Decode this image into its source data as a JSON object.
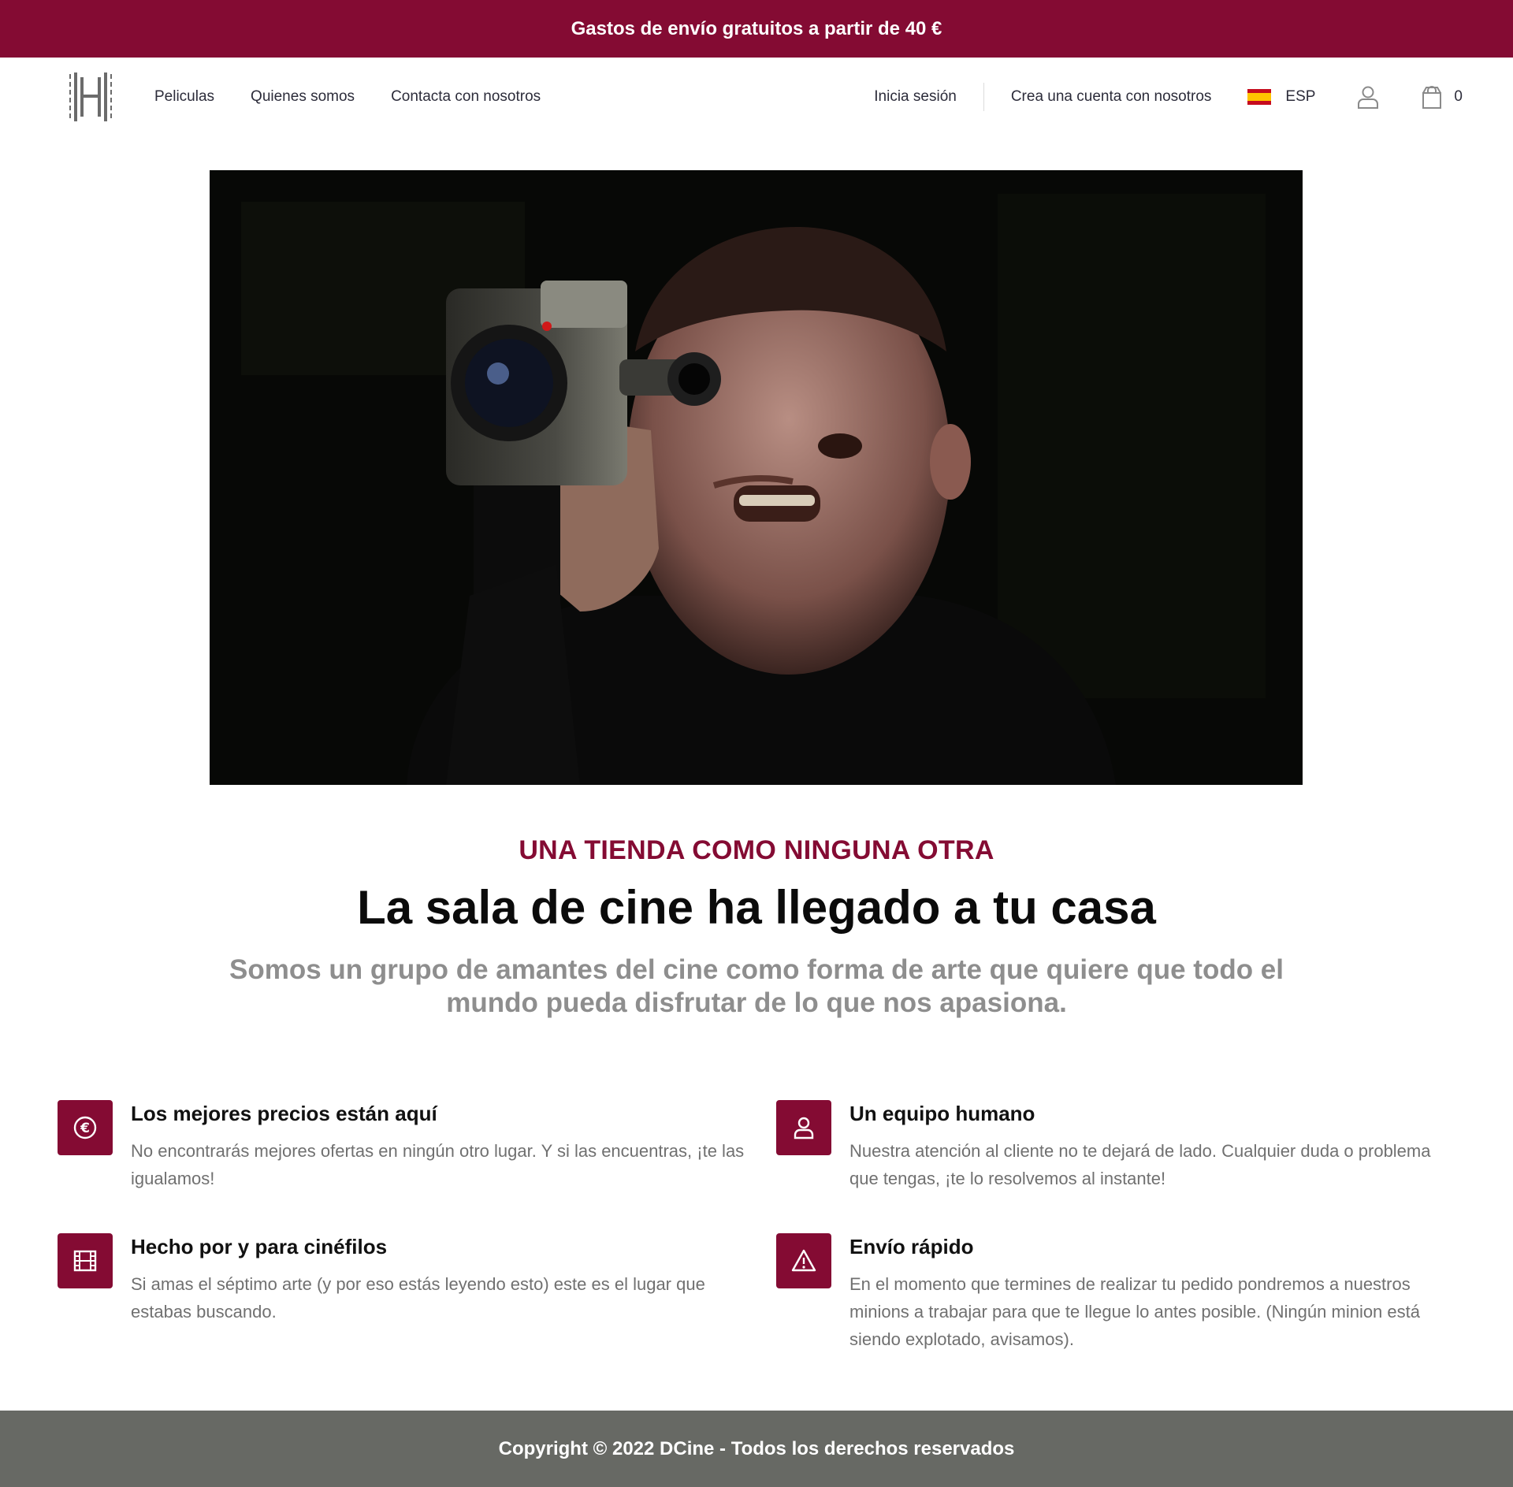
{
  "promo_bar": {
    "text": "Gastos de envío gratuitos a partir de 40 €"
  },
  "nav": {
    "logo_icon": "film-strip-logo-icon",
    "links": [
      "Peliculas",
      "Quienes somos",
      "Contacta con nosotros"
    ],
    "login": "Inicia sesión",
    "register": "Crea una cuenta con nosotros",
    "language": "ESP",
    "flag_icon": "spain-flag-icon",
    "user_icon": "user-icon",
    "cart_icon": "shopping-bag-icon",
    "cart_count": "0"
  },
  "intro": {
    "eyebrow": "UNA TIENDA COMO NINGUNA OTRA",
    "headline": "La sala de cine ha llegado a tu casa",
    "lead": "Somos un grupo de amantes del cine como forma de arte que quiere que todo el mundo pueda disfrutar de lo que nos apasiona."
  },
  "features": [
    {
      "icon": "euro-icon",
      "title": "Los mejores precios están aquí",
      "text": "No encontrarás mejores ofertas en ningún otro lugar. Y si las encuentras, ¡te las igualamos!"
    },
    {
      "icon": "user-icon",
      "title": "Un equipo humano",
      "text": "Nuestra atención al cliente no te dejará de lado. Cualquier duda o problema que tengas, ¡te lo resolvemos al instante!"
    },
    {
      "icon": "film-icon",
      "title": "Hecho por y para cinéfilos",
      "text": "Si amas el séptimo arte (y por eso estás leyendo esto) este es el lugar que estabas buscando."
    },
    {
      "icon": "warning-triangle-icon",
      "title": "Envío rápido",
      "text": "En el momento que termines de realizar tu pedido pondremos a nuestros minions a trabajar para que te llegue lo antes posible. (Ningún minion está siendo explotado, avisamos)."
    }
  ],
  "footer": {
    "text": "Copyright © 2022 DCine - Todos los derechos reservados"
  },
  "colors": {
    "brand": "#840b33",
    "footer": "#676964",
    "muted_text": "#8e8e8e"
  }
}
